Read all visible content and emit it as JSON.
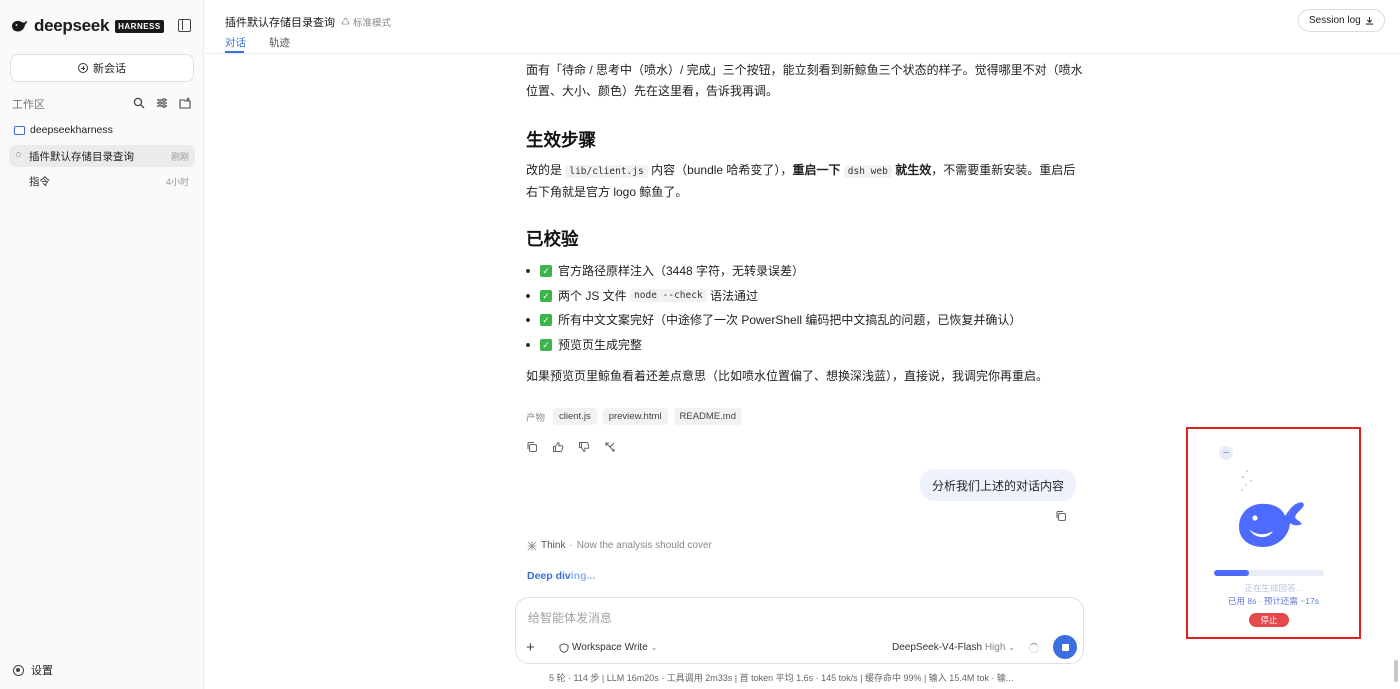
{
  "brand": {
    "name": "deepseek",
    "badge": "HARNESS"
  },
  "sidebar": {
    "new_chat": "新会话",
    "workspace_title": "工作区",
    "folder": "deepseekharness",
    "items": [
      {
        "label": "插件默认存储目录查询",
        "time": "刚刚"
      },
      {
        "label": "指令",
        "time": "4小时"
      }
    ],
    "settings": "设置"
  },
  "header": {
    "title": "插件默认存储目录查询",
    "mode": "标准模式",
    "tabs": [
      "对话",
      "轨迹"
    ],
    "session_log": "Session log"
  },
  "message": {
    "intro_line": "面有「待命 / 思考中（喷水）/ 完成」三个按钮，能立刻看到新鲸鱼三个状态的样子。觉得哪里不对（喷水",
    "intro_line2": "位置、大小、颜色）先在这里看，告诉我再调。",
    "h_effect": "生效步骤",
    "effect_a": "改的是",
    "effect_code1": "lib/client.js",
    "effect_b": "内容（bundle 哈希变了），",
    "effect_bold1": "重启一下",
    "effect_code2": "dsh web",
    "effect_bold2": "就生效",
    "effect_c": "，不需要重新安装。重启后",
    "effect_line2": "右下角就是官方 logo 鲸鱼了。",
    "h_verified": "已校验",
    "check1": "官方路径原样注入（3448 字符，无转录误差）",
    "check2a": "两个 JS 文件",
    "check2_code": "node --check",
    "check2b": "语法通过",
    "check3": "所有中文文案完好（中途修了一次 PowerShell 编码把中文搞乱的问题，已恢复并确认）",
    "check4": "预览页生成完整",
    "closing": "如果预览页里鲸鱼看着还差点意思（比如喷水位置偏了、想换深浅蓝），直接说，我调完你再重启。",
    "artifacts_label": "产物",
    "artifacts": [
      "client.js",
      "preview.html",
      "README.md"
    ]
  },
  "user_message": "分析我们上述的对话内容",
  "think": {
    "label": "Think",
    "sep": "·",
    "text": "Now the analysis should cover"
  },
  "deep_diving": {
    "main": "Deep div",
    "fade": "ing..."
  },
  "composer": {
    "placeholder": "给智能体发消息",
    "workspace_mode": "Workspace Write",
    "model": "DeepSeek-V4-Flash",
    "level": "High"
  },
  "footer_stats": "5 轮 · 114 步   |   LLM 16m20s · 工具调用 2m33s   |   首 token 平均 1.6s · 145 tok/s   |   缓存命中 99%   |   输入 15.4M tok · 输...",
  "widget": {
    "minimize": "–",
    "status": "正在生成回答...",
    "elapsed": "已用 8s · 预计还需 ~17s",
    "stop": "停止",
    "progress": 0.32
  },
  "colors": {
    "accent": "#3b6fe0",
    "whale": "#4d6bfe",
    "danger": "#e5484d",
    "highlight_border": "#e2201f"
  }
}
